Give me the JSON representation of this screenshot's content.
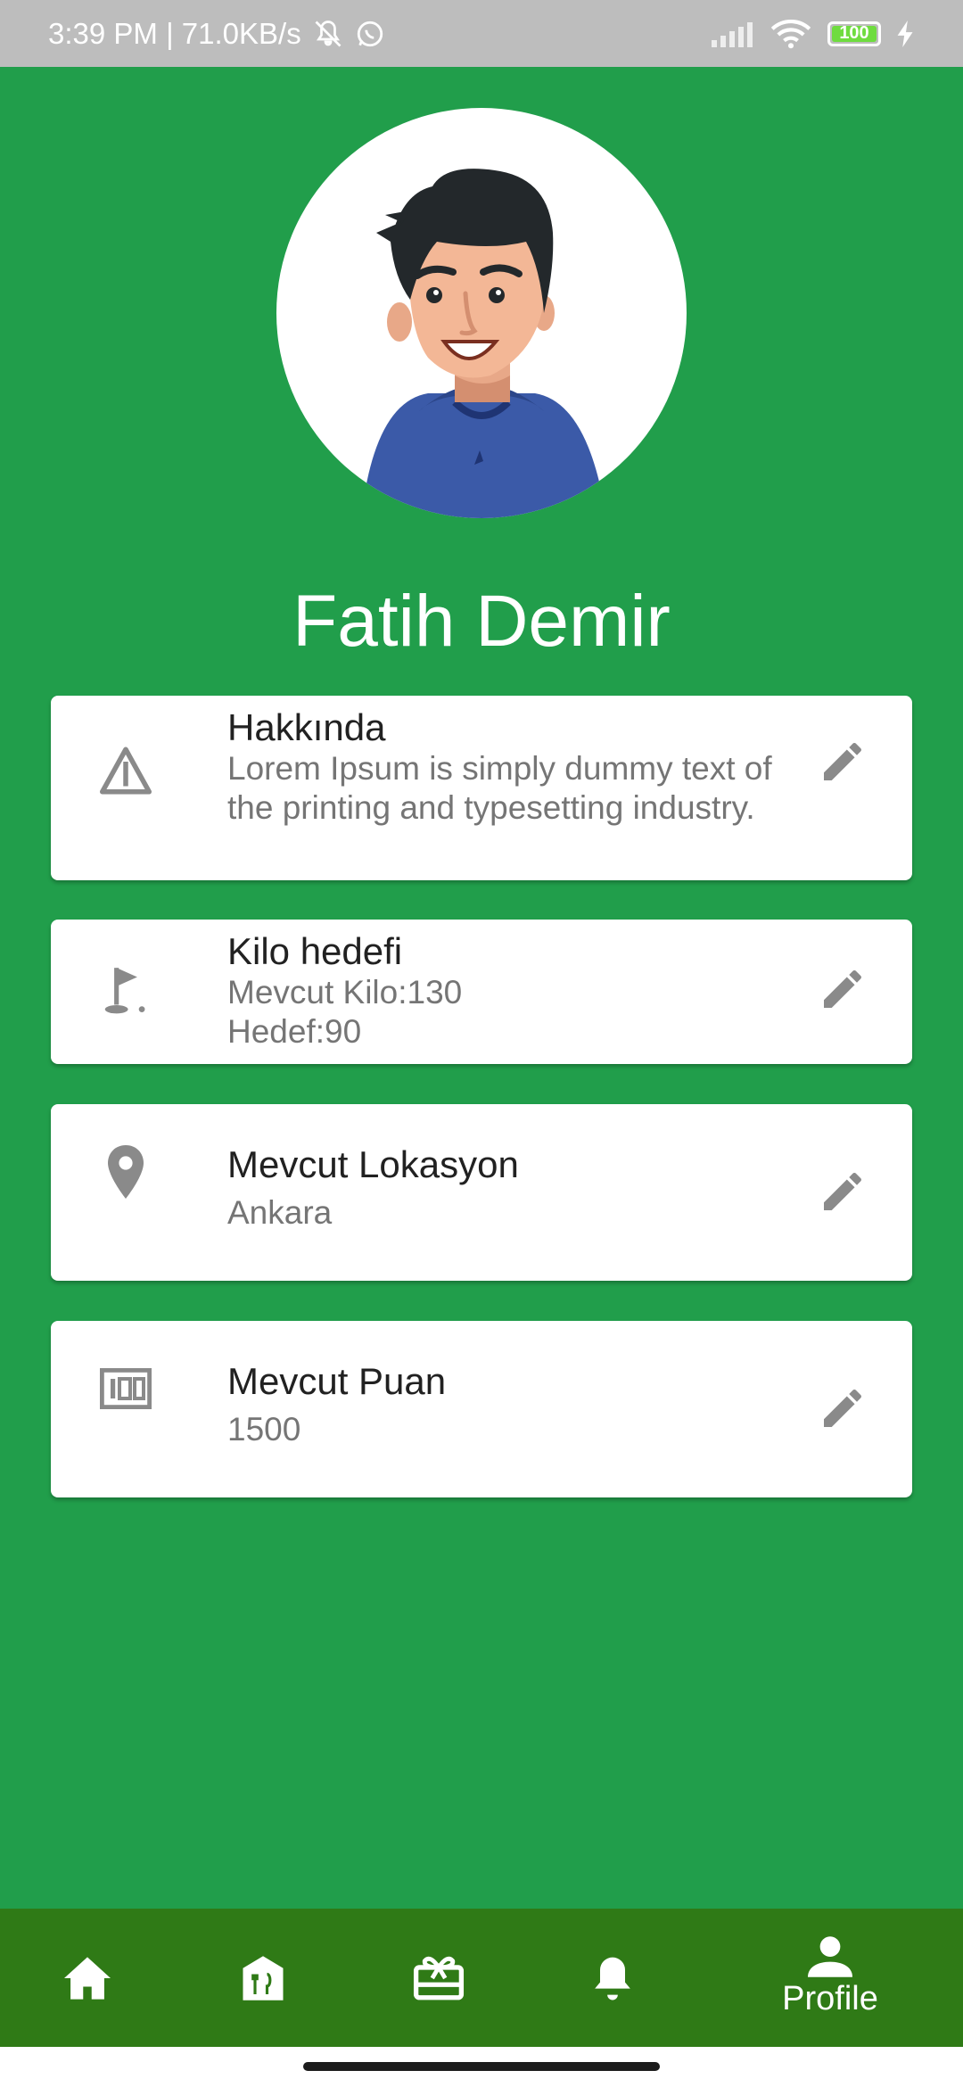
{
  "status_bar": {
    "time_speed": "3:39 PM | 71.0KB/s",
    "battery": "100",
    "icons": [
      "muted-bell-icon",
      "whatsapp-icon",
      "signal-icon",
      "wifi-icon",
      "battery-icon",
      "charging-icon"
    ]
  },
  "profile": {
    "name": "Fatih Demir",
    "avatar": "cartoon-man-avatar"
  },
  "cards": [
    {
      "icon": "warning-triangle-icon",
      "title": "Hakkında",
      "subtitle": "Lorem Ipsum is simply dummy text of the printing and typesetting industry."
    },
    {
      "icon": "golf-flag-icon",
      "title": "Kilo hedefi",
      "line1": "Mevcut Kilo:130",
      "line2": "Hedef:90"
    },
    {
      "icon": "location-pin-icon",
      "title": "Mevcut Lokasyon",
      "subtitle": "Ankara"
    },
    {
      "icon": "score-100-icon",
      "title": "Mevcut Puan",
      "subtitle": "1500"
    }
  ],
  "bottom_nav": {
    "items": [
      "home-icon",
      "restaurant-icon",
      "gift-card-icon",
      "bell-icon",
      "person-icon"
    ],
    "active_label": "Profile"
  },
  "colors": {
    "background": "#219e4b",
    "nav_background": "#2f7a16",
    "icon_grey": "#8a8a8a"
  }
}
